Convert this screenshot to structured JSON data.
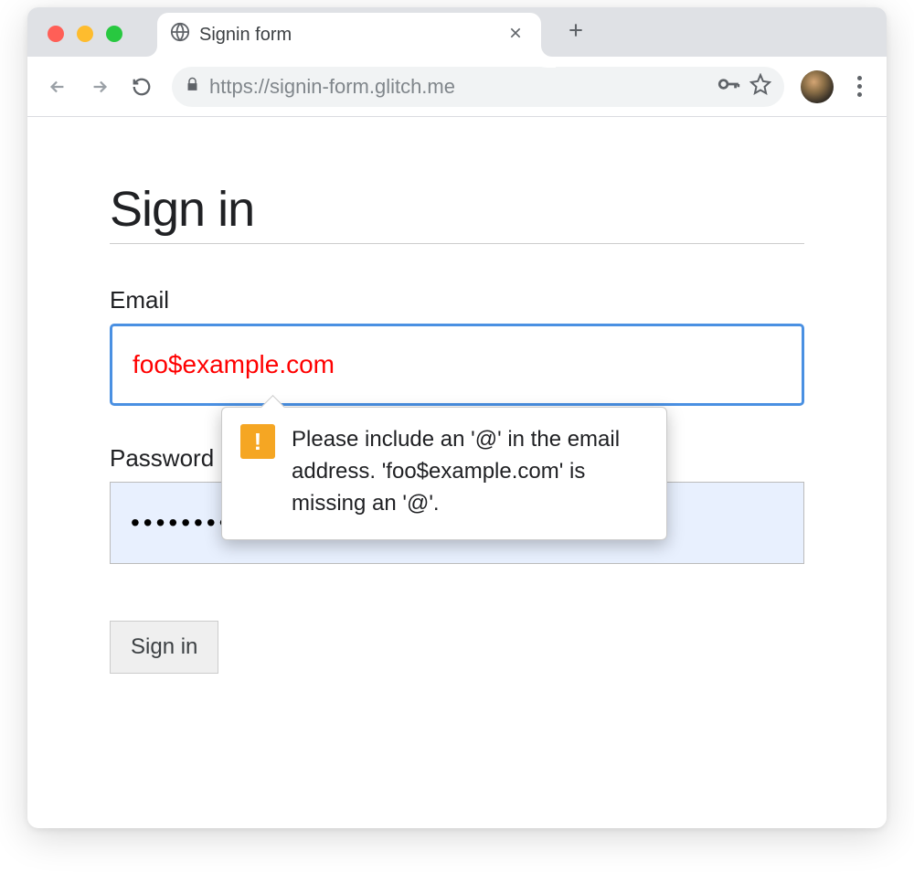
{
  "browser": {
    "tab_title": "Signin form",
    "url": "https://signin-form.glitch.me"
  },
  "page": {
    "heading": "Sign in",
    "email_label": "Email",
    "email_value": "foo$example.com",
    "password_label": "Password",
    "password_value": "•••••••••••",
    "submit_label": "Sign in"
  },
  "validation": {
    "message": "Please include an '@' in the email address. 'foo$example.com' is missing an '@'."
  },
  "icons": {
    "favicon": "globe-icon",
    "close_tab": "close-icon",
    "new_tab": "plus-icon",
    "back": "arrow-left-icon",
    "forward": "arrow-right-icon",
    "reload": "reload-icon",
    "lock": "lock-icon",
    "password_key": "key-icon",
    "bookmark": "star-icon",
    "menu": "kebab-menu-icon",
    "warning": "warning-icon"
  }
}
